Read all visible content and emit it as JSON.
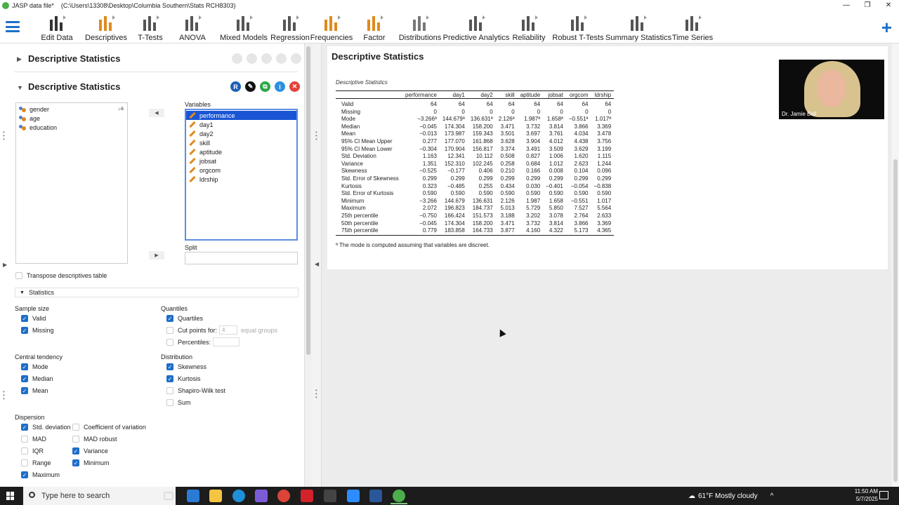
{
  "window": {
    "app_title": "JASP data file*",
    "path": "(C:\\Users\\13308\\Desktop\\Columbia Southern\\Stats RCH8303)"
  },
  "ribbon": {
    "buttons": [
      {
        "label": "Edit Data",
        "icon": "table-icon"
      },
      {
        "label": "Descriptives",
        "icon": "bar-chart-icon"
      },
      {
        "label": "T-Tests",
        "icon": "ttest-icon"
      },
      {
        "label": "ANOVA",
        "icon": "anova-icon"
      },
      {
        "label": "Mixed Models",
        "icon": "mixed-models-icon"
      },
      {
        "label": "Regression",
        "icon": "regression-icon"
      },
      {
        "label": "Frequencies",
        "icon": "frequencies-icon"
      },
      {
        "label": "Factor",
        "icon": "factor-icon"
      },
      {
        "label": "Distributions",
        "icon": "distributions-icon"
      },
      {
        "label": "Predictive Analytics",
        "icon": "predictive-icon"
      },
      {
        "label": "Reliability",
        "icon": "reliability-icon"
      },
      {
        "label": "Robust T-Tests",
        "icon": "robust-ttest-icon"
      },
      {
        "label": "Summary Statistics",
        "icon": "summary-stats-icon"
      },
      {
        "label": "Time Series",
        "icon": "time-series-icon"
      }
    ]
  },
  "analysis_collapsed": {
    "title": "Descriptive Statistics"
  },
  "analysis": {
    "title": "Descriptive Statistics",
    "source_vars": [
      "gender",
      "age",
      "education"
    ],
    "variables_label": "Variables",
    "variables": [
      "performance",
      "day1",
      "day2",
      "skill",
      "aptitude",
      "jobsat",
      "orgcom",
      "ldrship"
    ],
    "selected_variable": "performance",
    "split_label": "Split",
    "transpose_label": "Transpose descriptives table",
    "statistics_label": "Statistics",
    "sample_size": {
      "label": "Sample size",
      "valid": "Valid",
      "missing": "Missing"
    },
    "quantiles": {
      "label": "Quantiles",
      "quartiles": "Quartiles",
      "cut_points": "Cut points for:",
      "cut_points_value": "4",
      "equal_groups": "equal groups",
      "percentiles": "Percentiles:"
    },
    "central": {
      "label": "Central tendency",
      "mode": "Mode",
      "median": "Median",
      "mean": "Mean"
    },
    "distribution": {
      "label": "Distribution",
      "skewness": "Skewness",
      "kurtosis": "Kurtosis",
      "shapiro": "Shapiro-Wilk test",
      "sum": "Sum"
    },
    "dispersion": {
      "label": "Dispersion",
      "sd": "Std. deviation",
      "cv": "Coefficient of variation",
      "mad": "MAD",
      "mad_robust": "MAD robust",
      "iqr": "IQR",
      "variance": "Variance",
      "range": "Range",
      "minimum": "Minimum",
      "maximum": "Maximum"
    }
  },
  "output": {
    "title": "Descriptive Statistics",
    "table_caption": "Descriptive Statistics",
    "columns": [
      "performance",
      "day1",
      "day2",
      "skill",
      "aptitude",
      "jobsat",
      "orgcom",
      "ldrship"
    ],
    "rows": [
      {
        "label": "Valid",
        "values": [
          "64",
          "64",
          "64",
          "64",
          "64",
          "64",
          "64",
          "64"
        ]
      },
      {
        "label": "Missing",
        "values": [
          "0",
          "0",
          "0",
          "0",
          "0",
          "0",
          "0",
          "0"
        ]
      },
      {
        "label": "Mode",
        "values": [
          "−3.266ª",
          "144.679ª",
          "136.631ª",
          "2.126ª",
          "1.987ª",
          "1.658ª",
          "−0.551ª",
          "1.017ª"
        ]
      },
      {
        "label": "Median",
        "values": [
          "−0.045",
          "174.304",
          "158.200",
          "3.471",
          "3.732",
          "3.814",
          "3.866",
          "3.369"
        ]
      },
      {
        "label": "Mean",
        "values": [
          "−0.013",
          "173.987",
          "159.343",
          "3.501",
          "3.697",
          "3.761",
          "4.034",
          "3.478"
        ]
      },
      {
        "label": "95% CI Mean Upper",
        "values": [
          "0.277",
          "177.070",
          "161.868",
          "3.628",
          "3.904",
          "4.012",
          "4.438",
          "3.756"
        ]
      },
      {
        "label": "95% CI Mean Lower",
        "values": [
          "−0.304",
          "170.904",
          "156.817",
          "3.374",
          "3.491",
          "3.509",
          "3.629",
          "3.199"
        ]
      },
      {
        "label": "Std. Deviation",
        "values": [
          "1.163",
          "12.341",
          "10.112",
          "0.508",
          "0.827",
          "1.006",
          "1.620",
          "1.115"
        ]
      },
      {
        "label": "Variance",
        "values": [
          "1.351",
          "152.310",
          "102.245",
          "0.258",
          "0.684",
          "1.012",
          "2.623",
          "1.244"
        ]
      },
      {
        "label": "Skewness",
        "values": [
          "−0.525",
          "−0.177",
          "0.406",
          "0.210",
          "0.166",
          "0.008",
          "0.104",
          "0.096"
        ]
      },
      {
        "label": "Std. Error of Skewness",
        "values": [
          "0.299",
          "0.299",
          "0.299",
          "0.299",
          "0.299",
          "0.299",
          "0.299",
          "0.299"
        ]
      },
      {
        "label": "Kurtosis",
        "values": [
          "0.323",
          "−0.485",
          "0.255",
          "0.434",
          "0.030",
          "−0.401",
          "−0.054",
          "−0.838"
        ]
      },
      {
        "label": "Std. Error of Kurtosis",
        "values": [
          "0.590",
          "0.590",
          "0.590",
          "0.590",
          "0.590",
          "0.590",
          "0.590",
          "0.590"
        ]
      },
      {
        "label": "Minimum",
        "values": [
          "−3.266",
          "144.679",
          "136.631",
          "2.126",
          "1.987",
          "1.658",
          "−0.551",
          "1.017"
        ]
      },
      {
        "label": "Maximum",
        "values": [
          "2.072",
          "196.823",
          "184.737",
          "5.013",
          "5.729",
          "5.850",
          "7.527",
          "5.564"
        ]
      },
      {
        "label": "25th percentile",
        "values": [
          "−0.750",
          "166.424",
          "151.573",
          "3.188",
          "3.202",
          "3.078",
          "2.764",
          "2.633"
        ]
      },
      {
        "label": "50th percentile",
        "values": [
          "−0.045",
          "174.304",
          "158.200",
          "3.471",
          "3.732",
          "3.814",
          "3.866",
          "3.369"
        ]
      },
      {
        "label": "75th percentile",
        "values": [
          "0.779",
          "183.858",
          "164.733",
          "3.877",
          "4.160",
          "4.322",
          "5.173",
          "4.365"
        ]
      }
    ],
    "footnote": "ª The mode is computed assuming that variables are discreet."
  },
  "webcam": {
    "caption": "Dr. Jamie Ball"
  },
  "taskbar": {
    "search_placeholder": "Type here to search",
    "weather": "61°F  Mostly cloudy",
    "time": "11:50 AM",
    "date": "5/7/2025"
  },
  "colors": {
    "accent": "#1e70c8",
    "selected": "#1a55d6",
    "orange": "#e08a1e"
  }
}
